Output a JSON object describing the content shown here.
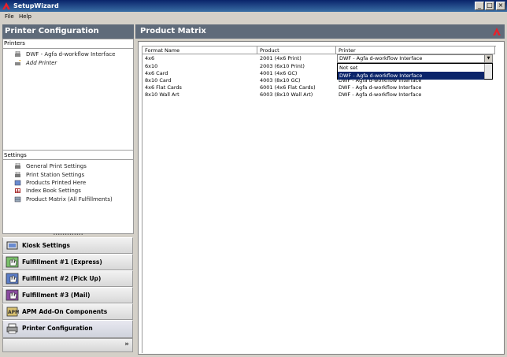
{
  "window": {
    "title": "SetupWizard"
  },
  "menu": [
    "File",
    "Help"
  ],
  "left_panel": {
    "header": "Printer Configuration",
    "printers_label": "Printers",
    "printers": [
      "DWF - Agfa d-workflow Interface",
      "Add Printer"
    ],
    "settings_label": "Settings",
    "settings": [
      "General Print Settings",
      "Print Station Settings",
      "Products Printed Here",
      "Index Book Settings",
      "Product Matrix (All Fulfillments)"
    ]
  },
  "nav": [
    "Kiosk Settings",
    "Fulfillment #1 (Express)",
    "Fulfillment #2 (Pick Up)",
    "Fulfillment #3 (Mail)",
    "APM Add-On Components",
    "Printer Configuration"
  ],
  "right_panel": {
    "header": "Product Matrix",
    "columns": [
      "Format Name",
      "Product",
      "Printer"
    ],
    "rows": [
      [
        "4x6",
        "2001 (4x6 Print)",
        "DWF - Agfa d-workflow Interface"
      ],
      [
        "6x10",
        "2003 (6x10 Print)",
        ""
      ],
      [
        "4x6 Card",
        "4001 (4x6 GC)",
        ""
      ],
      [
        "8x10 Card",
        "4003 (8x10 GC)",
        "DWF - Agfa d-workflow Interface"
      ],
      [
        "4x6 Flat Cards",
        "6001 (4x6 Flat Cards)",
        "DWF - Agfa d-workflow Interface"
      ],
      [
        "8x10 Wall Art",
        "6003 (8x10 Wall Art)",
        "DWF - Agfa d-workflow Interface"
      ]
    ],
    "dropdown": {
      "value": "DWF - Agfa d-workflow Interface",
      "options": [
        "Not set",
        "DWF - Agfa d-workflow Interface"
      ]
    }
  }
}
